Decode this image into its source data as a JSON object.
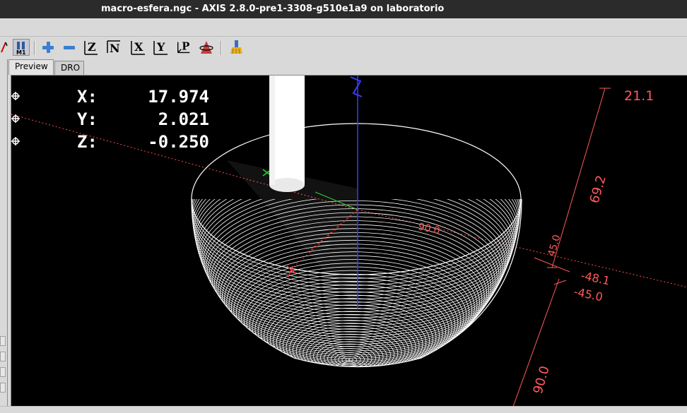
{
  "window": {
    "title": "macro-esfera.ngc - AXIS 2.8.0-pre1-3308-g510e1a9 on laboratorio"
  },
  "toolbar": {
    "m1_label": "M1",
    "view_z": "Z",
    "view_p": "P"
  },
  "tabs": [
    {
      "label": "Preview",
      "active": true
    },
    {
      "label": "DRO",
      "active": false
    }
  ],
  "dro": {
    "x_label": "X:",
    "x_value": "17.974",
    "y_label": "Y:",
    "y_value": "2.021",
    "z_label": "Z:",
    "z_value": "-0.250"
  },
  "dimensions": {
    "z_max": "21.1",
    "z_extent": "69.2",
    "y_extent_small": "45.0",
    "x_extent": "90.0",
    "x_min": "-48.1",
    "y_min": "-45.0",
    "y_extent": "90.0"
  },
  "colors": {
    "background": "#000000",
    "toolpath": "#ffffff",
    "extents": "#ff5a5a",
    "z_axis": "#3a3aff",
    "x_axis": "#ff3030",
    "y_axis": "#30d030"
  }
}
